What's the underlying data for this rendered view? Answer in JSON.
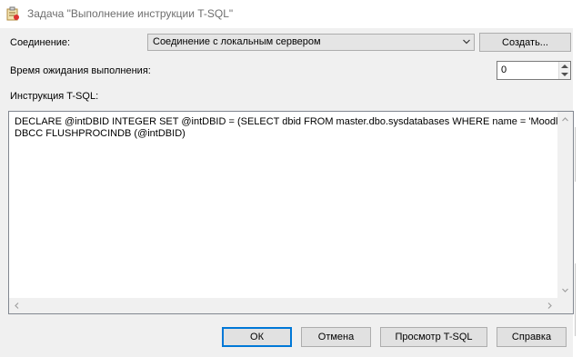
{
  "window": {
    "title": "Задача \"Выполнение инструкции T-SQL\"",
    "icon": "task-icon"
  },
  "connection": {
    "label": "Соединение:",
    "selected": "Соединение с локальным сервером",
    "create_label": "Создать..."
  },
  "timeout": {
    "label": "Время ожидания выполнения:",
    "value": "0"
  },
  "sql": {
    "label": "Инструкция T-SQL:",
    "lines": [
      "DECLARE @intDBID INTEGER SET @intDBID = (SELECT dbid FROM master.dbo.sysdatabases WHERE name = 'Moodle')",
      "DBCC FLUSHPROCINDB (@intDBID)"
    ]
  },
  "buttons": {
    "ok": "ОК",
    "cancel": "Отмена",
    "preview": "Просмотр T-SQL",
    "help": "Справка"
  },
  "colors": {
    "focus_border": "#0078d7",
    "dialog_bg": "#f0f0f0"
  }
}
